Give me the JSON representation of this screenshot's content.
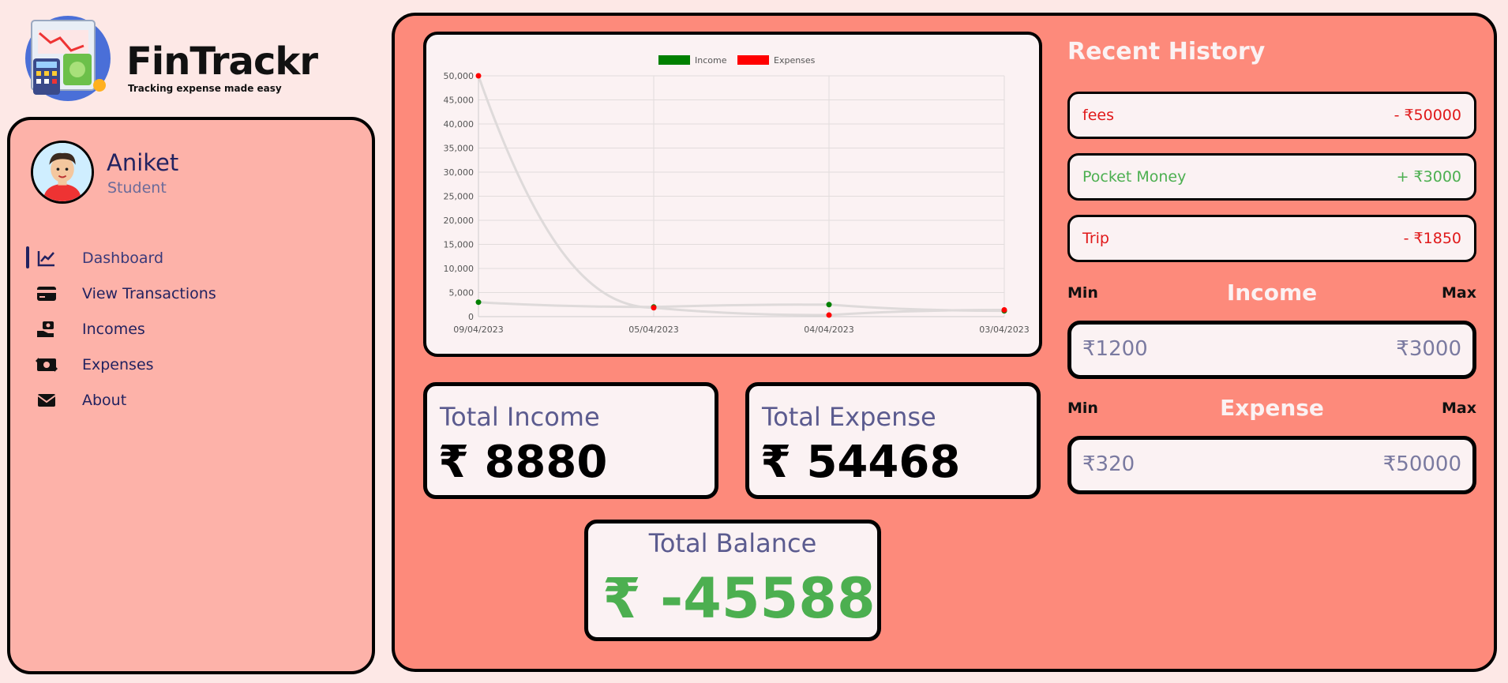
{
  "brand": {
    "title": "FinTrackr",
    "tagline": "Tracking expense made easy"
  },
  "user": {
    "name": "Aniket",
    "role": "Student"
  },
  "nav": [
    {
      "label": "Dashboard",
      "icon": "chart-line-icon",
      "active": true
    },
    {
      "label": "View Transactions",
      "icon": "credit-card-icon",
      "active": false
    },
    {
      "label": "Incomes",
      "icon": "money-hand-icon",
      "active": false
    },
    {
      "label": "Expenses",
      "icon": "money-bill-icon",
      "active": false
    },
    {
      "label": "About",
      "icon": "envelope-icon",
      "active": false
    }
  ],
  "chart_data": {
    "type": "line",
    "x": [
      "09/04/2023",
      "05/04/2023",
      "04/04/2023",
      "03/04/2023"
    ],
    "series": [
      {
        "name": "Income",
        "values": [
          3000,
          2000,
          2500,
          1200
        ],
        "color": "#008000"
      },
      {
        "name": "Expenses",
        "values": [
          50000,
          1850,
          320,
          1400
        ],
        "color": "#ff0000"
      }
    ],
    "yticks": [
      "0",
      "5,000",
      "10,000",
      "15,000",
      "20,000",
      "25,000",
      "30,000",
      "35,000",
      "40,000",
      "45,000",
      "50,000"
    ],
    "ylim": [
      0,
      50000
    ],
    "legend": "top",
    "grid": true
  },
  "totals": {
    "income_label": "Total Income",
    "income_value": "₹ 8880",
    "expense_label": "Total Expense",
    "expense_value": "₹ 54468",
    "balance_label": "Total Balance",
    "balance_value": "₹ -45588"
  },
  "history": {
    "title": "Recent History",
    "items": [
      {
        "name": "fees",
        "amount": "- ₹50000",
        "kind": "expense"
      },
      {
        "name": "Pocket Money",
        "amount": "+ ₹3000",
        "kind": "income"
      },
      {
        "name": "Trip",
        "amount": "- ₹1850",
        "kind": "expense"
      }
    ]
  },
  "ranges": {
    "min_label": "Min",
    "max_label": "Max",
    "income": {
      "title": "Income",
      "min": "₹1200",
      "max": "₹3000"
    },
    "expense": {
      "title": "Expense",
      "min": "₹320",
      "max": "₹50000"
    }
  },
  "colors": {
    "income": "#4caf50",
    "expense": "#e0191a",
    "sidebar_bg": "#fdb2a9",
    "main_bg": "#fd8a7b",
    "card_bg": "#fbf2f3"
  }
}
